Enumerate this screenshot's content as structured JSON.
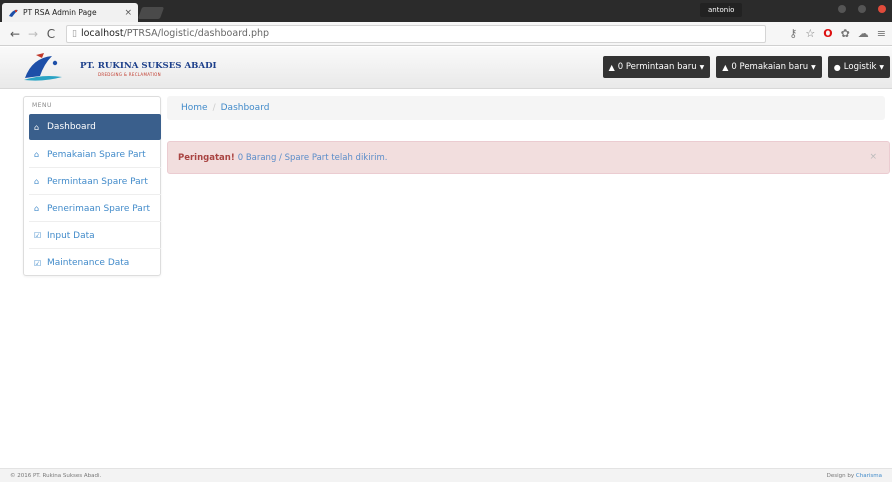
{
  "browser": {
    "tab_title": "PT RSA Admin Page",
    "tab_close": "×",
    "profile": "antonio",
    "url_scheme": "localhost",
    "url_path": "/PTRSA/logistic/dashboard.php"
  },
  "brand": {
    "name": "PT. RUKINA SUKSES ABADI",
    "tagline": "DREDGING & RECLAMATION",
    "logo_colors": {
      "blue": "#1d4fa8",
      "red": "#c0392b",
      "teal": "#2aa3c4"
    }
  },
  "navbar": {
    "permintaan": {
      "label": "0 Permintaan baru",
      "icon": "bell-icon"
    },
    "pemakaian": {
      "label": "0 Pemakaian baru",
      "icon": "bell-icon"
    },
    "user": {
      "label": "Logistik",
      "icon": "user-icon"
    }
  },
  "sidebar": {
    "menu_label": "MENU",
    "items": [
      {
        "label": "Dashboard",
        "icon": "home-icon",
        "active": true
      },
      {
        "label": "Pemakaian Spare Part",
        "icon": "home-icon"
      },
      {
        "label": "Permintaan Spare Part",
        "icon": "home-icon"
      },
      {
        "label": "Penerimaan Spare Part",
        "icon": "home-icon"
      },
      {
        "label": "Input Data",
        "icon": "check-square-icon"
      },
      {
        "label": "Maintenance Data",
        "icon": "check-square-icon"
      }
    ]
  },
  "breadcrumb": {
    "home": "Home",
    "separator": "/",
    "current": "Dashboard"
  },
  "alert": {
    "strong": "Peringatan!",
    "message": "0 Barang / Spare Part telah dikirim.",
    "close": "×"
  },
  "footer": {
    "copyright": "© 2016 PT. Rukina Sukses Abadi.",
    "design_prefix": "Design by",
    "design_by": "Charisma"
  },
  "colors": {
    "accent": "#428bca",
    "active_nav": "#3a5f8c",
    "alert_bg": "#f2dede",
    "alert_text": "#a94442"
  }
}
